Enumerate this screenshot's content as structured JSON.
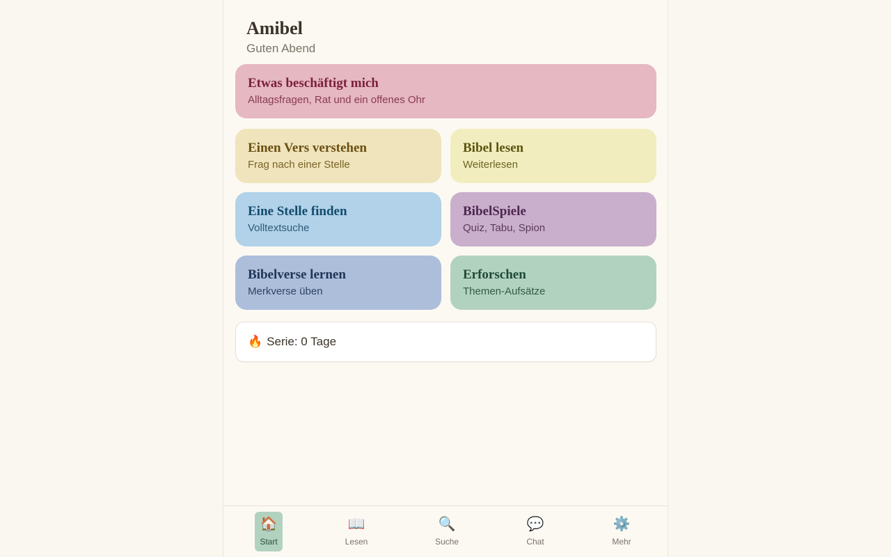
{
  "app": {
    "title": "Amibel",
    "greeting": "Guten Abend"
  },
  "cards": [
    {
      "title": "Etwas beschäftigt mich",
      "subtitle": "Alltagsfragen, Rat und ein offenes Ohr"
    },
    {
      "title": "Einen Vers verstehen",
      "subtitle": "Frag nach einer Stelle"
    },
    {
      "title": "Bibel lesen",
      "subtitle": "Weiterlesen"
    },
    {
      "title": "Eine Stelle finden",
      "subtitle": "Volltextsuche"
    },
    {
      "title": "BibelSpiele",
      "subtitle": "Quiz, Tabu, Spion"
    },
    {
      "title": "Bibelverse lernen",
      "subtitle": "Merkverse üben"
    },
    {
      "title": "Erforschen",
      "subtitle": "Themen-Aufsätze"
    }
  ],
  "streak": {
    "icon": "🔥",
    "text": "Serie: 0 Tage"
  },
  "nav": [
    {
      "label": "Start",
      "icon": "🏠",
      "icon_name": "home-icon",
      "active": true
    },
    {
      "label": "Lesen",
      "icon": "📖",
      "icon_name": "book-icon",
      "active": false
    },
    {
      "label": "Suche",
      "icon": "🔍",
      "icon_name": "search-icon",
      "active": false
    },
    {
      "label": "Chat",
      "icon": "💬",
      "icon_name": "chat-icon",
      "active": false
    },
    {
      "label": "Mehr",
      "icon": "⚙️",
      "icon_name": "gear-icon",
      "active": false
    }
  ]
}
